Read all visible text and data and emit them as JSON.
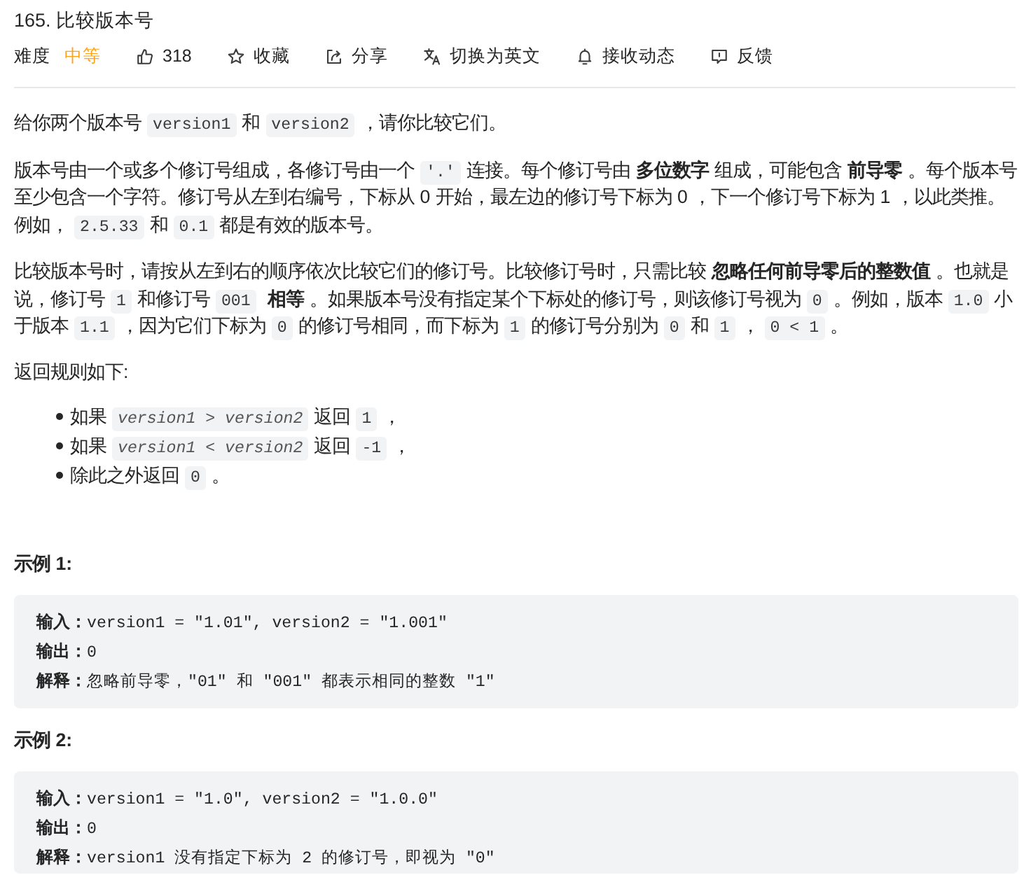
{
  "problem": {
    "title": "165. 比较版本号"
  },
  "meta": {
    "difficulty_label": "难度",
    "difficulty": "中等",
    "actions": [
      {
        "kind": "like",
        "label": "318"
      },
      {
        "kind": "favorite",
        "label": "收藏"
      },
      {
        "kind": "share",
        "label": "分享"
      },
      {
        "kind": "translate",
        "label": "切换为英文"
      },
      {
        "kind": "subscribe",
        "label": "接收动态"
      },
      {
        "kind": "feedback",
        "label": "反馈"
      }
    ]
  },
  "description": {
    "paragraphs": [
      {
        "segments": [
          {
            "kind": "text",
            "text": "给你两个版本号"
          },
          {
            "kind": "code",
            "text": "version1"
          },
          {
            "kind": "text",
            "text": "和"
          },
          {
            "kind": "code",
            "text": "version2"
          },
          {
            "kind": "text",
            "text": "，请你比较它们。"
          }
        ]
      },
      {
        "segments": [
          {
            "kind": "text",
            "text": "版本号由一个或多个修订号组成，各修订号由一个"
          },
          {
            "kind": "code",
            "text": "'.'"
          },
          {
            "kind": "text",
            "text": "连接。每个修订号由"
          },
          {
            "kind": "bold",
            "text": "多位数字"
          },
          {
            "kind": "text",
            "text": "组成，可能包含"
          },
          {
            "kind": "bold",
            "text": "前导零"
          },
          {
            "kind": "text",
            "text": "。每个版本号至少包含一个字符。修订号从左到右编号，下标从 0 开始，最左边的修订号下标为 0 ，下一个修订号下标为 1 ，以此类推。例如，"
          },
          {
            "kind": "code",
            "text": "2.5.33"
          },
          {
            "kind": "text",
            "text": "和"
          },
          {
            "kind": "code",
            "text": "0.1"
          },
          {
            "kind": "text",
            "text": "都是有效的版本号。"
          }
        ]
      },
      {
        "segments": [
          {
            "kind": "text",
            "text": "比较版本号时，请按从左到右的顺序依次比较它们的修订号。比较修订号时，只需比较"
          },
          {
            "kind": "bold",
            "text": "忽略任何前导零后的整数值"
          },
          {
            "kind": "text",
            "text": "。也就是说，修订号"
          },
          {
            "kind": "code",
            "text": "1"
          },
          {
            "kind": "text",
            "text": "和修订号"
          },
          {
            "kind": "code",
            "text": "001"
          },
          {
            "kind": "bold",
            "text": "相等"
          },
          {
            "kind": "text",
            "text": "。如果版本号没有指定某个下标处的修订号，则该修订号视为"
          },
          {
            "kind": "code",
            "text": "0"
          },
          {
            "kind": "text",
            "text": "。例如，版本"
          },
          {
            "kind": "code",
            "text": "1.0"
          },
          {
            "kind": "text",
            "text": "小于版本"
          },
          {
            "kind": "code",
            "text": "1.1"
          },
          {
            "kind": "text",
            "text": "，因为它们下标为"
          },
          {
            "kind": "code",
            "text": "0"
          },
          {
            "kind": "text",
            "text": "的修订号相同，而下标为"
          },
          {
            "kind": "code",
            "text": "1"
          },
          {
            "kind": "text",
            "text": "的修订号分别为"
          },
          {
            "kind": "code",
            "text": "0"
          },
          {
            "kind": "text",
            "text": "和"
          },
          {
            "kind": "code",
            "text": "1"
          },
          {
            "kind": "text",
            "text": "，"
          },
          {
            "kind": "code",
            "text": "0 < 1"
          },
          {
            "kind": "text",
            "text": "。"
          }
        ]
      }
    ],
    "rules_intro": "返回规则如下:",
    "rules": [
      {
        "segments": [
          {
            "kind": "text",
            "text": "如果"
          },
          {
            "kind": "var",
            "text": "version1 > version2"
          },
          {
            "kind": "text",
            "text": "返回"
          },
          {
            "kind": "code",
            "text": "1"
          },
          {
            "kind": "text",
            "text": "，"
          }
        ]
      },
      {
        "segments": [
          {
            "kind": "text",
            "text": "如果"
          },
          {
            "kind": "var",
            "text": "version1 < version2"
          },
          {
            "kind": "text",
            "text": "返回"
          },
          {
            "kind": "code",
            "text": "-1"
          },
          {
            "kind": "text",
            "text": "，"
          }
        ]
      },
      {
        "segments": [
          {
            "kind": "text",
            "text": "除此之外返回"
          },
          {
            "kind": "code",
            "text": "0"
          },
          {
            "kind": "text",
            "text": "。"
          }
        ]
      }
    ]
  },
  "examples": [
    {
      "heading": "示例 1:",
      "lines": [
        {
          "label": "输入：",
          "value": "version1 = \"1.01\", version2 = \"1.001\""
        },
        {
          "label": "输出：",
          "value": "0"
        },
        {
          "label": "解释：",
          "value": "忽略前导零，\"01\" 和 \"001\" 都表示相同的整数 \"1\""
        }
      ]
    },
    {
      "heading": "示例 2:",
      "lines": [
        {
          "label": "输入：",
          "value": "version1 = \"1.0\", version2 = \"1.0.0\""
        },
        {
          "label": "输出：",
          "value": "0"
        },
        {
          "label": "解释：",
          "value": "version1 没有指定下标为 2 的修订号，即视为 \"0\""
        }
      ]
    }
  ]
}
